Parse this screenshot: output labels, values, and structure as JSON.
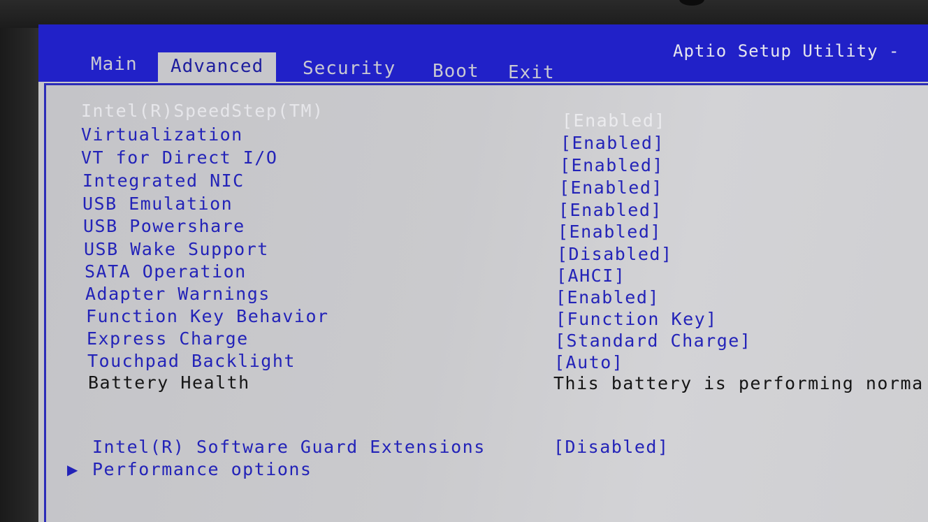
{
  "tabs": [
    {
      "label": "Main"
    },
    {
      "label": "Advanced"
    },
    {
      "label": "Security"
    },
    {
      "label": "Boot"
    },
    {
      "label": "Exit"
    }
  ],
  "active_tab": "Advanced",
  "utility_title": "Aptio Setup Utility -",
  "settings": [
    {
      "label": "Intel(R)SpeedStep(TM)",
      "value": "[Enabled]"
    },
    {
      "label": "Virtualization",
      "value": "[Enabled]"
    },
    {
      "label": "VT for Direct I/O",
      "value": "[Enabled]"
    },
    {
      "label": "Integrated NIC",
      "value": "[Enabled]"
    },
    {
      "label": "USB Emulation",
      "value": "[Enabled]"
    },
    {
      "label": "USB Powershare",
      "value": "[Enabled]"
    },
    {
      "label": "USB Wake Support",
      "value": "[Disabled]"
    },
    {
      "label": "SATA Operation",
      "value": "[AHCI]"
    },
    {
      "label": "Adapter Warnings",
      "value": "[Enabled]"
    },
    {
      "label": "Function Key Behavior",
      "value": "[Function Key]"
    },
    {
      "label": "Express Charge",
      "value": "[Standard Charge]"
    },
    {
      "label": "Touchpad Backlight",
      "value": "[Auto]"
    },
    {
      "label": "Battery Health",
      "value": "This battery is performing norma"
    },
    {
      "label": "Intel(R) Software Guard Extensions",
      "value": "[Disabled]"
    }
  ],
  "submenu": {
    "label": "Performance options",
    "pointer_icon": "triangle-right-icon"
  },
  "colors": {
    "header_blue": "#2121c8",
    "panel_gray": "#c7c7cb",
    "item_text_blue": "#2323b8",
    "highlight_text": "#e6e6ea",
    "static_text": "#151515"
  }
}
